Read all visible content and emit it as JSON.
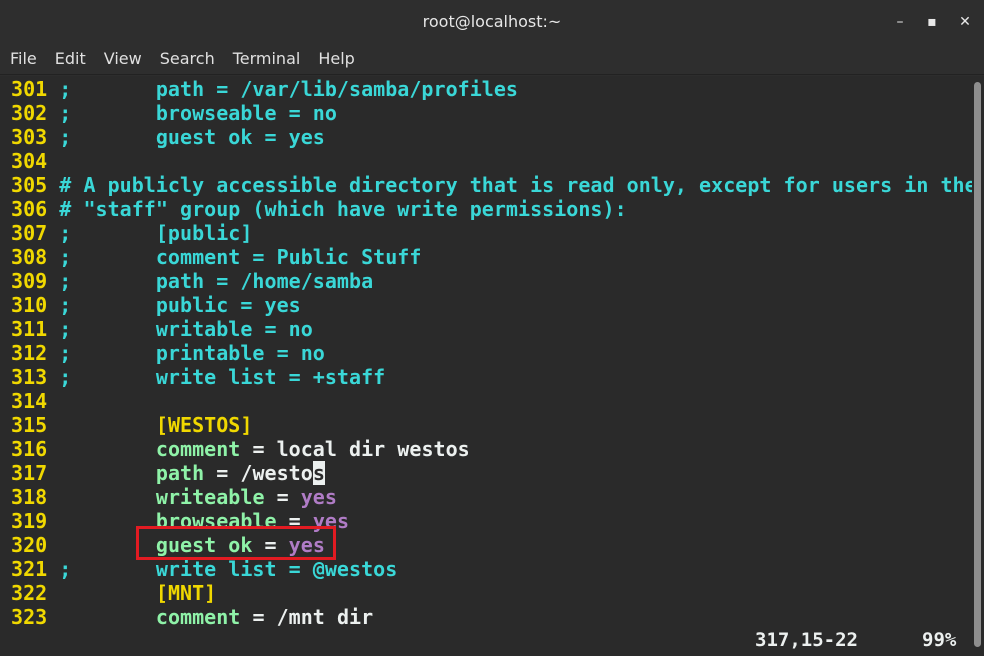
{
  "window": {
    "title": "root@localhost:~",
    "controls": {
      "minimize": "–",
      "maximize": "▪",
      "close": "✕"
    }
  },
  "menu": [
    "File",
    "Edit",
    "View",
    "Search",
    "Terminal",
    "Help"
  ],
  "lines": [
    {
      "n": "301",
      "parts": [
        [
          "cm",
          ";       path = /var/lib/samba/profiles"
        ]
      ]
    },
    {
      "n": "302",
      "parts": [
        [
          "cm",
          ";       browseable = no"
        ]
      ]
    },
    {
      "n": "303",
      "parts": [
        [
          "cm",
          ";       guest ok = yes"
        ]
      ]
    },
    {
      "n": "304",
      "parts": []
    },
    {
      "n": "305",
      "parts": [
        [
          "cm",
          "# A publicly accessible directory that is read only, except for users in the"
        ]
      ]
    },
    {
      "n": "306",
      "parts": [
        [
          "cm",
          "# \"staff\" group (which have write permissions):"
        ]
      ]
    },
    {
      "n": "307",
      "parts": [
        [
          "cm",
          ";       [public]"
        ]
      ]
    },
    {
      "n": "308",
      "parts": [
        [
          "cm",
          ";       comment = Public Stuff"
        ]
      ]
    },
    {
      "n": "309",
      "parts": [
        [
          "cm",
          ";       path = /home/samba"
        ]
      ]
    },
    {
      "n": "310",
      "parts": [
        [
          "cm",
          ";       public = yes"
        ]
      ]
    },
    {
      "n": "311",
      "parts": [
        [
          "cm",
          ";       writable = no"
        ]
      ]
    },
    {
      "n": "312",
      "parts": [
        [
          "cm",
          ";       printable = no"
        ]
      ]
    },
    {
      "n": "313",
      "parts": [
        [
          "cm",
          ";       write list = +staff"
        ]
      ]
    },
    {
      "n": "314",
      "parts": []
    },
    {
      "n": "315",
      "parts": [
        [
          "wht",
          "        "
        ],
        [
          "sec",
          "[WESTOS]"
        ]
      ]
    },
    {
      "n": "316",
      "parts": [
        [
          "wht",
          "        "
        ],
        [
          "key",
          "comment"
        ],
        [
          "wht",
          " = local dir westos"
        ]
      ]
    },
    {
      "n": "317",
      "parts": [
        [
          "wht",
          "        "
        ],
        [
          "key",
          "path"
        ],
        [
          "wht",
          " = /westo"
        ],
        [
          "cursor",
          "s"
        ]
      ]
    },
    {
      "n": "318",
      "parts": [
        [
          "wht",
          "        "
        ],
        [
          "key",
          "writeable"
        ],
        [
          "wht",
          " = "
        ],
        [
          "val",
          "yes"
        ]
      ]
    },
    {
      "n": "319",
      "parts": [
        [
          "wht",
          "        "
        ],
        [
          "key",
          "browseable"
        ],
        [
          "wht",
          " = "
        ],
        [
          "val",
          "yes"
        ]
      ]
    },
    {
      "n": "320",
      "parts": [
        [
          "wht",
          "        "
        ],
        [
          "key",
          "guest ok"
        ],
        [
          "wht",
          " = "
        ],
        [
          "val",
          "yes"
        ]
      ]
    },
    {
      "n": "321",
      "parts": [
        [
          "cm",
          ";       write list = @westos"
        ]
      ]
    },
    {
      "n": "322",
      "parts": [
        [
          "wht",
          "        "
        ],
        [
          "sec",
          "[MNT]"
        ]
      ]
    },
    {
      "n": "323",
      "parts": [
        [
          "wht",
          "        "
        ],
        [
          "key",
          "comment"
        ],
        [
          "wht",
          " = /mnt dir"
        ]
      ]
    }
  ],
  "status": {
    "position": "317,15-22",
    "percent": "99%"
  },
  "colors": {
    "line_number": "#f0d800",
    "comment": "#3ad7d7",
    "key": "#8ff2a8",
    "value": "#b07cc6",
    "highlight_border": "#e21b22"
  }
}
